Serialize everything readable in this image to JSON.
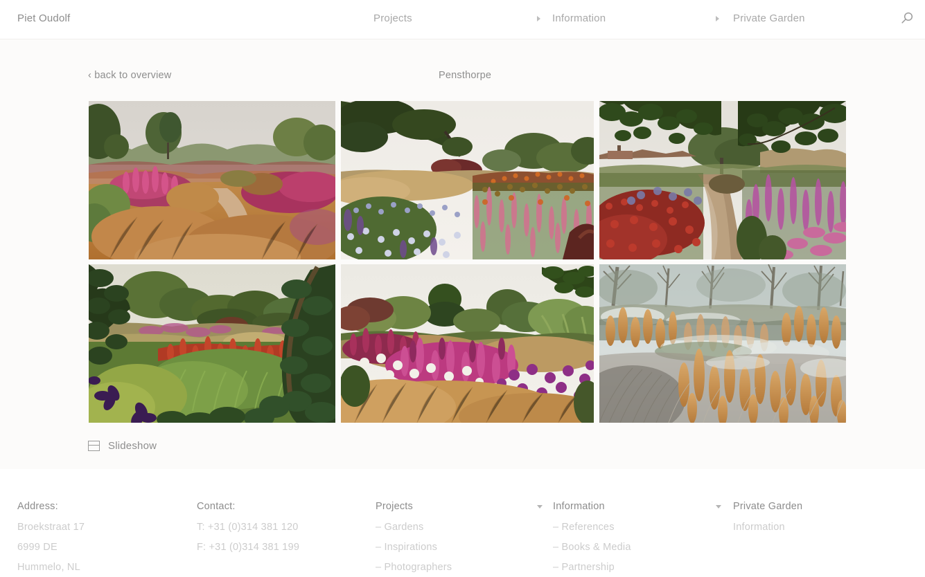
{
  "header": {
    "logo": "Piet Oudolf",
    "nav": [
      {
        "label": "Projects",
        "has_arrow": false
      },
      {
        "label": "Information",
        "has_arrow": true
      },
      {
        "label": "Private Garden",
        "has_arrow": true
      }
    ],
    "search_icon": "search-icon"
  },
  "content": {
    "back_link": "‹ back to overview",
    "gallery_title": "Pensthorpe",
    "slideshow_label": "Slideshow",
    "slideshow_icon": "slideshow-icon",
    "images": [
      {
        "alt": "Prairie border with magenta astilbe spires, copper molinia grasses and a gravel path under a pale overcast sky",
        "sky": "#dedad4",
        "palette": [
          "#c9c4bc",
          "#5d7041",
          "#b8446f",
          "#c8854a",
          "#a8622f",
          "#7d8c4e"
        ]
      },
      {
        "alt": "Mature oak tree over meadow planting with lavender asters, pink persicaria spikes and orange heleniums",
        "sky": "#eeeae4",
        "palette": [
          "#e9e5df",
          "#3f5228",
          "#8d93bf",
          "#d9a0ae",
          "#d4682a",
          "#c4a96a"
        ]
      },
      {
        "alt": "Gravel path framed by overhanging beech leaves with red crocosmia on the left and purple lythrum on the right",
        "sky": "#e4e0da",
        "palette": [
          "#e2ded7",
          "#2f4420",
          "#a33024",
          "#7f7ba6",
          "#b2547f",
          "#a89073"
        ]
      },
      {
        "alt": "Lush green summer garden framed by dark foliage with a band of red persicaria and a purple clematis in the foreground",
        "sky": "#dcdcd2",
        "palette": [
          "#d7d8cc",
          "#2a3c1a",
          "#8fa544",
          "#b03a22",
          "#4a5f27",
          "#53286b"
        ]
      },
      {
        "alt": "Late-summer border with magenta lythrum, white umbels, purple vernonia and tawny deschampsia grasses",
        "sky": "#ebe8e2",
        "palette": [
          "#e8e5de",
          "#4a6030",
          "#bc3a7a",
          "#d8c9ad",
          "#c79a52",
          "#8e3a72"
        ]
      },
      {
        "alt": "Frosted winter garden with copper seed heads of astilbe and hoarfrost on grasses beside bare trees",
        "sky": "#cfd6d6",
        "palette": [
          "#c6cfd1",
          "#8a9a9c",
          "#c8803c",
          "#e0ad62",
          "#6f6f6a",
          "#dfe4e3"
        ]
      }
    ]
  },
  "footer": {
    "columns": [
      {
        "name": "address",
        "heading": "Address:",
        "lines": [
          "Broekstraat 17",
          "6999 DE",
          "Hummelo, NL"
        ],
        "caret": false
      },
      {
        "name": "contact",
        "heading": "Contact:",
        "lines": [
          "T: +31 (0)314 381 120",
          "F: +31 (0)314 381 199"
        ],
        "caret": false
      },
      {
        "name": "projects",
        "heading": "Projects",
        "lines": [
          "– Gardens",
          "– Inspirations",
          "– Photographers"
        ],
        "caret": false
      },
      {
        "name": "information",
        "heading": "Information",
        "lines": [
          "– References",
          "– Books & Media",
          "– Partnership"
        ],
        "caret": true
      },
      {
        "name": "private-garden",
        "heading": "Private Garden",
        "lines": [
          "Information"
        ],
        "caret": true
      }
    ]
  },
  "colors": {
    "page_background": "#ffffff",
    "content_background": "#fcfbfa",
    "text_primary": "#8c8c8c",
    "text_muted": "#cccccc",
    "marker": "#b5b5b5"
  }
}
